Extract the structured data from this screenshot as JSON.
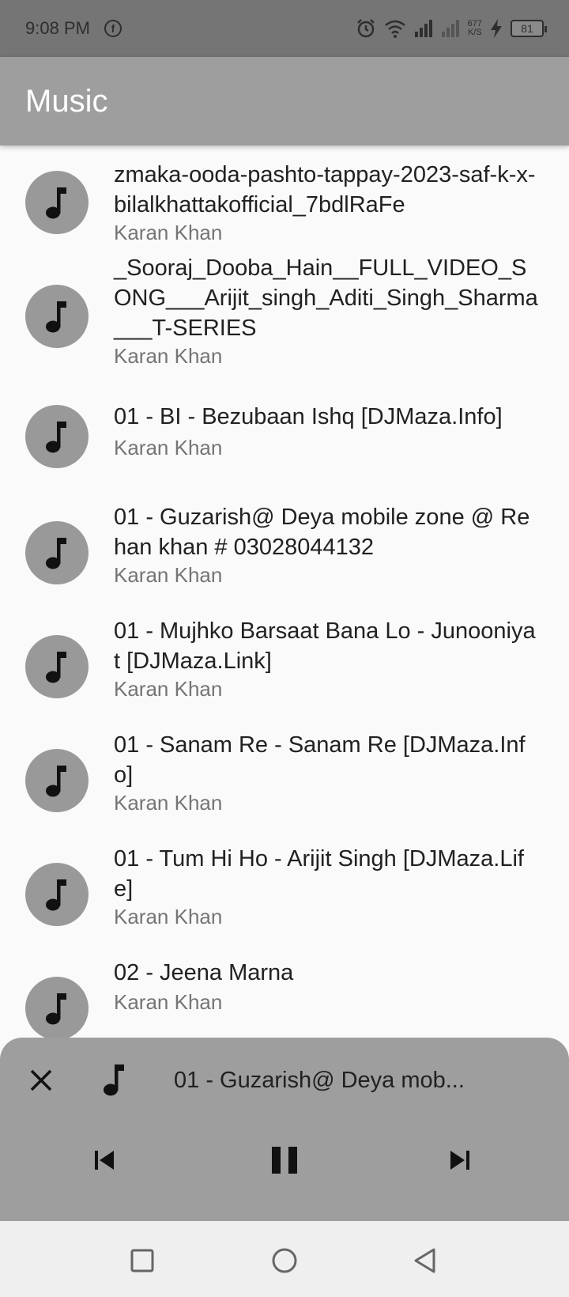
{
  "status_bar": {
    "time": "9:08 PM",
    "net_speed_value": "677",
    "net_speed_unit": "K/S",
    "battery": "81",
    "icons": [
      "facebook-icon",
      "alarm-icon",
      "wifi-icon",
      "signal-icon",
      "signal-empty-icon",
      "charging-icon",
      "battery-icon"
    ]
  },
  "app_bar": {
    "title": "Music"
  },
  "songs": [
    {
      "title": "zmaka-ooda-pashto-tappay-2023-saf-k-x-bilalkhattakofficial_7bdlRaFe",
      "artist": "Karan Khan"
    },
    {
      "title": "_Sooraj_Dooba_Hain__FULL_VIDEO_SONG___Arijit_singh_Aditi_Singh_Sharma___T-SERIES",
      "artist": "Karan Khan"
    },
    {
      "title": "01 - BI - Bezubaan Ishq [DJMaza.Info]",
      "artist": "Karan Khan"
    },
    {
      "title": "01 - Guzarish@  Deya mobile zone @ Rehan khan # 03028044132",
      "artist": "Karan Khan"
    },
    {
      "title": "01 - Mujhko Barsaat Bana Lo - Junooniyat [DJMaza.Link]",
      "artist": "Karan Khan"
    },
    {
      "title": "01 - Sanam Re - Sanam Re [DJMaza.Info]",
      "artist": "Karan Khan"
    },
    {
      "title": "01 - Tum Hi Ho - Arijit Singh [DJMaza.Life]",
      "artist": "Karan Khan"
    },
    {
      "title": "02 - Jeena Marna",
      "artist": "Karan Khan"
    }
  ],
  "mini_player": {
    "now_playing": "01 - Guzarish@  Deya mob...",
    "state": "playing",
    "icons": [
      "close-icon",
      "music-note-icon",
      "skip-previous-icon",
      "pause-icon",
      "skip-next-icon"
    ]
  },
  "nav_bar": {
    "icons": [
      "recents-square-icon",
      "home-circle-icon",
      "back-triangle-icon"
    ]
  },
  "colors": {
    "status_bar": "#757575",
    "app_bar": "#9e9e9e",
    "avatar": "#999999",
    "background": "#fafafa",
    "mini_player": "#9e9e9e"
  }
}
